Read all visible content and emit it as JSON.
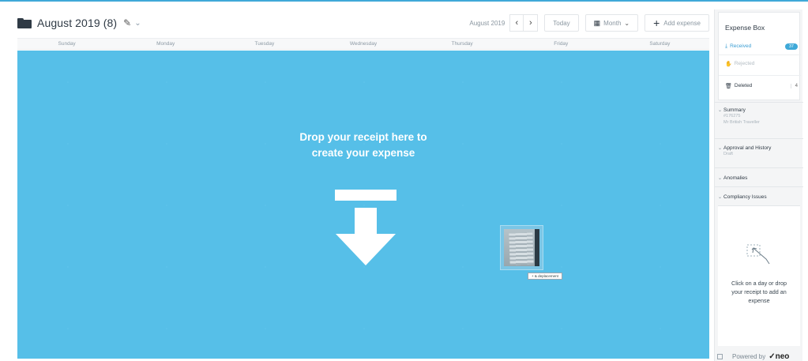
{
  "header": {
    "title": "August 2019 (8)",
    "toolbar": {
      "date_label": "August 2019",
      "today_label": "Today",
      "view_label": "Month",
      "add_label": "Add expense"
    }
  },
  "calendar": {
    "days": [
      "Sunday",
      "Monday",
      "Tuesday",
      "Wednesday",
      "Thursday",
      "Friday",
      "Saturday"
    ]
  },
  "dropzone": {
    "line1": "Drop your receipt here to",
    "line2": "create your expense",
    "drag_tag": "+ & deplacement"
  },
  "sidebar": {
    "expense_box": {
      "title": "Expense Box",
      "received_label": "Received",
      "received_count": "37",
      "rejected_label": "Rejected",
      "deleted_label": "Deleted",
      "deleted_count": "4"
    },
    "sections": {
      "summary": {
        "label": "Summary",
        "sub1": "#176275",
        "sub2": "Mr British Traveller"
      },
      "approval": {
        "label": "Approval and History",
        "sub1": "Draft"
      },
      "anomalies": {
        "label": "Anomalies"
      },
      "compliancy": {
        "label": "Compliancy Issues"
      }
    },
    "empty_state": {
      "line1": "Click on a day or drop",
      "line2": "your receipt to add an",
      "line3": "expense"
    },
    "powered_by": "Powered by",
    "brand": "✓neo"
  },
  "colors": {
    "accent": "#3fa9d8",
    "dropzone": "#56bfe8"
  }
}
